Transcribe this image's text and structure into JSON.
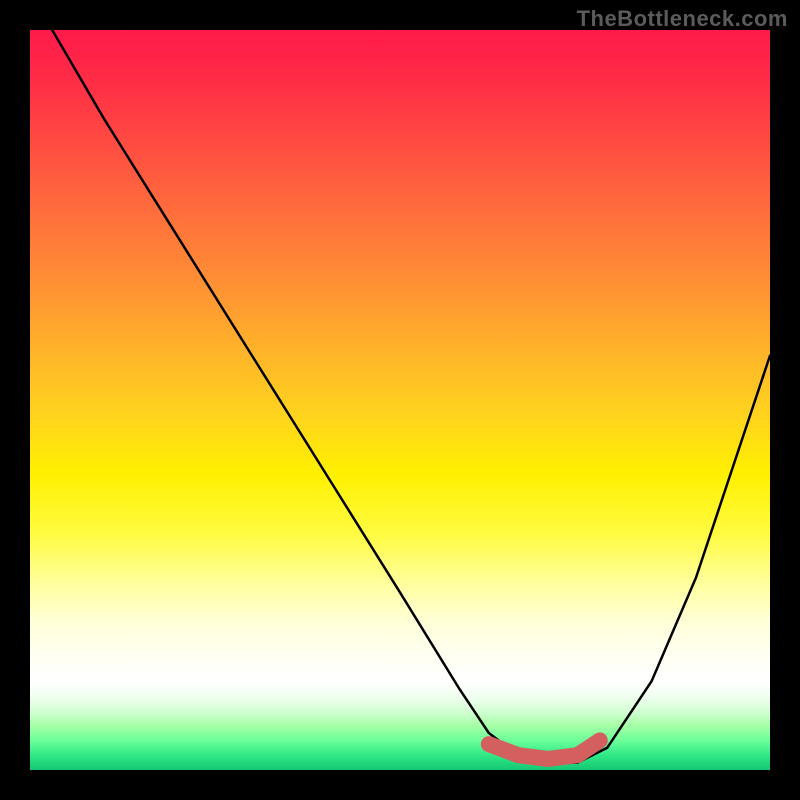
{
  "watermark": "TheBottleneck.com",
  "chart_data": {
    "type": "line",
    "title": "",
    "xlabel": "",
    "ylabel": "",
    "xlim": [
      0,
      100
    ],
    "ylim": [
      0,
      100
    ],
    "grid": false,
    "legend": false,
    "series": [
      {
        "name": "bottleneck-curve",
        "x": [
          3,
          10,
          20,
          30,
          40,
          50,
          58,
          62,
          66,
          70,
          74,
          78,
          84,
          90,
          96,
          100
        ],
        "y": [
          100,
          88,
          72,
          56,
          40,
          24,
          11,
          5,
          2,
          1,
          1,
          3,
          12,
          26,
          44,
          56
        ]
      },
      {
        "name": "highlight-band",
        "x": [
          62,
          66,
          70,
          74,
          77
        ],
        "y": [
          3.5,
          2,
          1.5,
          2,
          4
        ],
        "color": "#d3605f",
        "style": "thick"
      }
    ],
    "background_gradient": {
      "orientation": "vertical",
      "stops": [
        {
          "pos": 0.0,
          "color": "#ff1a4b"
        },
        {
          "pos": 0.25,
          "color": "#ff6f3c"
        },
        {
          "pos": 0.5,
          "color": "#ffd31e"
        },
        {
          "pos": 0.7,
          "color": "#fffb40"
        },
        {
          "pos": 0.85,
          "color": "#ffffff"
        },
        {
          "pos": 1.0,
          "color": "#14c774"
        }
      ]
    }
  }
}
